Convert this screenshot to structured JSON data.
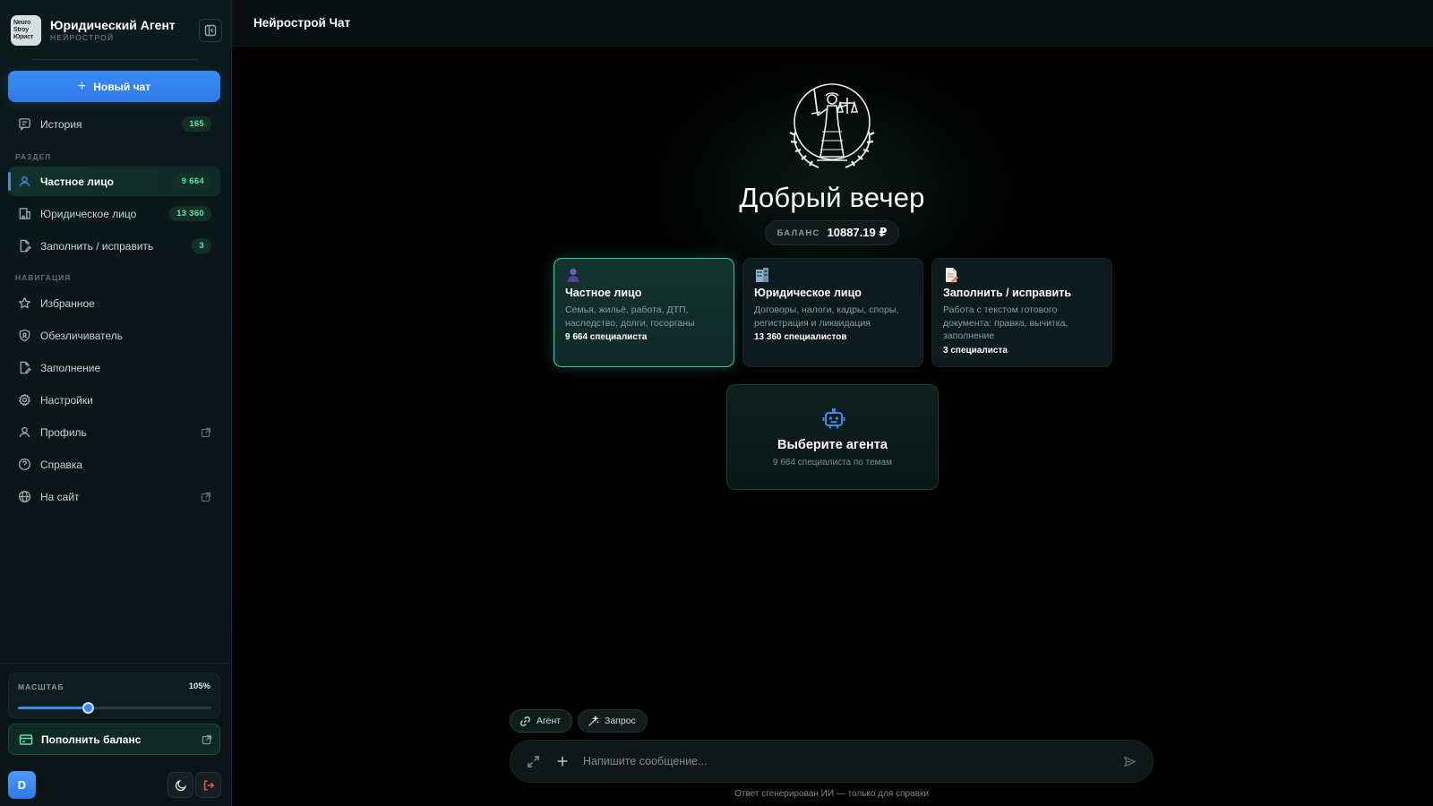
{
  "brand": {
    "logo_text": [
      "Neuro",
      "Stroy",
      "Юрист"
    ],
    "title": "Юридический Агент",
    "subtitle": "НЕЙРОСТРОЙ"
  },
  "sidebar": {
    "new_chat": "Новый чат",
    "history": {
      "label": "История",
      "badge": "165"
    },
    "section_label": "РАЗДЕЛ",
    "sections": [
      {
        "label": "Частное лицо",
        "badge": "9 664",
        "icon": "user-icon",
        "active": true
      },
      {
        "label": "Юридическое лицо",
        "badge": "13 360",
        "icon": "building-icon",
        "active": false
      },
      {
        "label": "Заполнить / исправить",
        "badge": "3",
        "icon": "file-edit-icon",
        "active": false
      }
    ],
    "nav_label": "НАВИГАЦИЯ",
    "nav": [
      {
        "label": "Избранное",
        "icon": "star-icon"
      },
      {
        "label": "Обезличиватель",
        "icon": "shield-icon"
      },
      {
        "label": "Заполнение",
        "icon": "file-edit-icon"
      },
      {
        "label": "Настройки",
        "icon": "gear-icon"
      },
      {
        "label": "Профиль",
        "icon": "user-icon",
        "external": true
      },
      {
        "label": "Справка",
        "icon": "help-icon"
      },
      {
        "label": "На сайт",
        "icon": "globe-icon",
        "external": true
      }
    ],
    "zoom": {
      "label": "МАСШТАБ",
      "value": "105%",
      "fraction": 0.36
    },
    "topup": "Пополнить баланс",
    "avatar_letter": "D"
  },
  "topbar": {
    "title": "Нейрострой Чат"
  },
  "hero": {
    "greeting": "Добрый вечер",
    "balance_label": "БАЛАНС",
    "balance_value": "10887.19 ₽"
  },
  "cards": [
    {
      "title": "Частное лицо",
      "desc": "Семья, жильё, работа, ДТП, наследство, долги, госорганы",
      "count": "9 664 специалиста",
      "icon": "person-icon"
    },
    {
      "title": "Юридическое лицо",
      "desc": "Договоры, налоги, кадры, споры, регистрация и ликвидация",
      "count": "13 360 специалистов",
      "icon": "building-icon"
    },
    {
      "title": "Заполнить / исправить",
      "desc": "Работа с текстом готового документа: правка, вычитка, заполнение",
      "count": "3 специалиста",
      "icon": "document-icon"
    }
  ],
  "agent_picker": {
    "title": "Выберите агента",
    "subtitle": "9 664 специалиста по темам"
  },
  "composer": {
    "chips": [
      "Агент",
      "Запрос"
    ],
    "placeholder": "Напишите сообщение...",
    "disclaimer": "Ответ сгенерирован ИИ — только для справки"
  },
  "colors": {
    "accent_blue": "#3a8cf5",
    "accent_green": "#37c9a0",
    "badge_text": "#5fe3a7"
  }
}
